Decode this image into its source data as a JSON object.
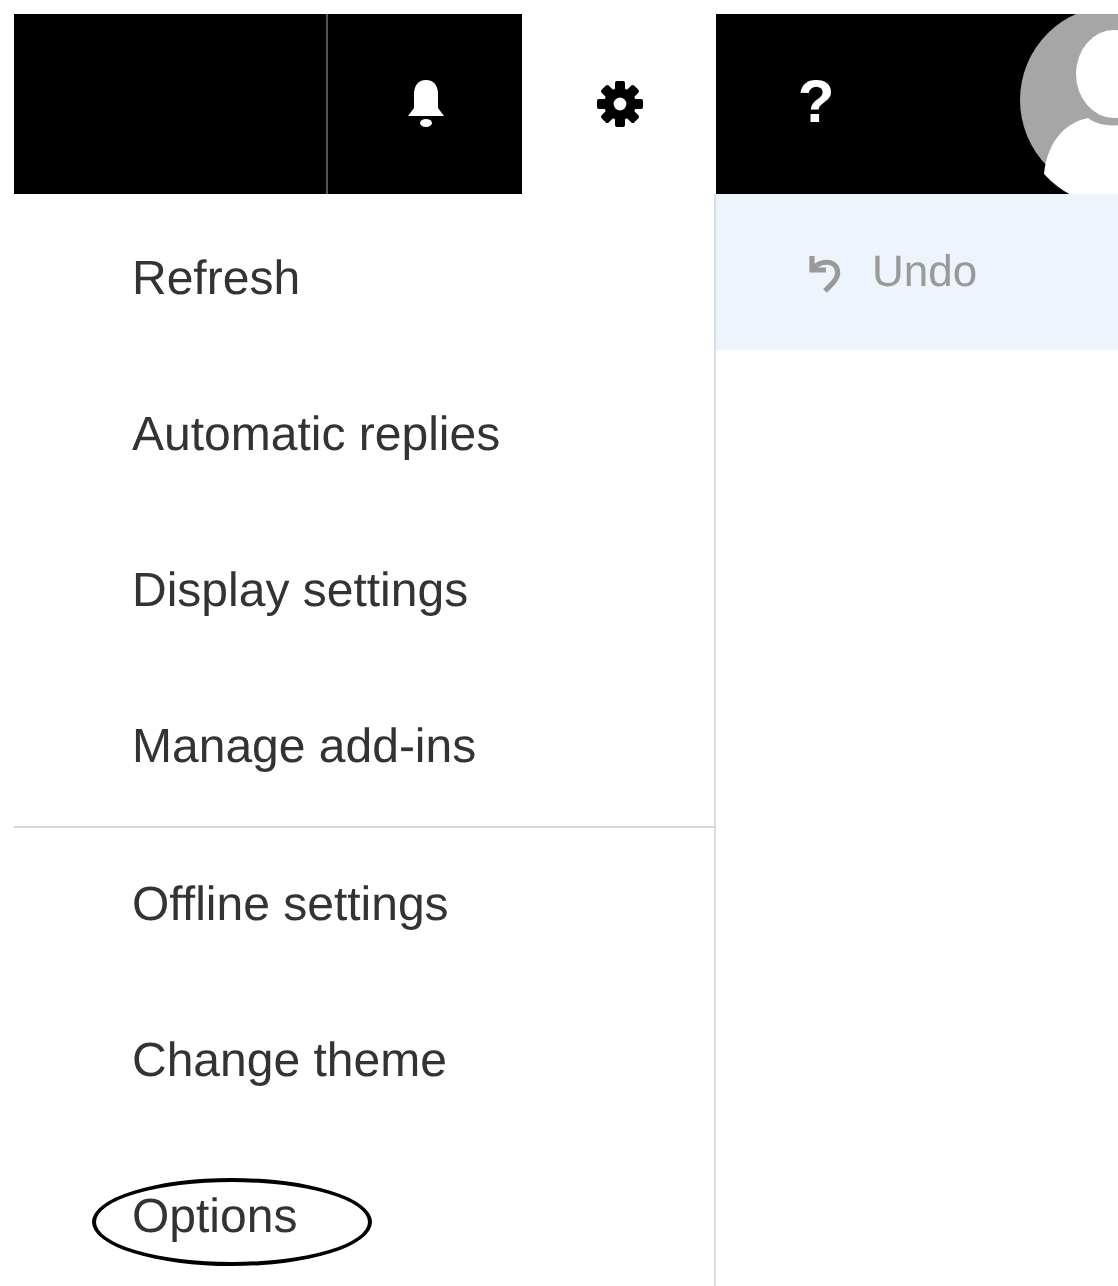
{
  "top_bar": [
    {
      "kind": "blank"
    },
    {
      "kind": "bell",
      "selected": false
    },
    {
      "kind": "gear",
      "selected": true
    },
    {
      "kind": "help",
      "label": "?",
      "selected": false
    },
    {
      "kind": "avatar"
    }
  ],
  "menu": {
    "sections": [
      {
        "items": [
          {
            "label": "Refresh",
            "circled": false
          },
          {
            "label": "Automatic replies",
            "circled": false
          },
          {
            "label": "Display settings",
            "circled": false
          },
          {
            "label": "Manage add-ins",
            "circled": false
          }
        ]
      },
      {
        "items": [
          {
            "label": "Offline settings",
            "circled": false
          },
          {
            "label": "Change theme",
            "circled": false
          },
          {
            "label": "Options",
            "circled": true
          }
        ]
      }
    ]
  },
  "command_bar": {
    "undo": {
      "label": "Undo"
    }
  }
}
